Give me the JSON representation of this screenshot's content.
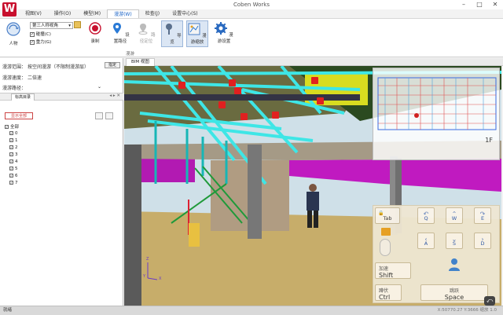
{
  "app": {
    "title": "Coben Works",
    "logo_letter": "W",
    "brand_color": "#c8102e"
  },
  "menu": {
    "items": [
      "视图(V)",
      "操作(O)",
      "模型(M)",
      "漫游(W)",
      "检查(J)",
      "设置中心(S)"
    ],
    "active_index": 3
  },
  "ribbon": {
    "view_mode": {
      "label": "人物",
      "select_value": "第三人称视角",
      "check1": "碰撞(C)",
      "check2": "重力(G)"
    },
    "buttons": [
      {
        "label": "录制",
        "icon": "record-icon"
      },
      {
        "label": "设置路径",
        "icon": "path-pin-icon"
      },
      {
        "label": "路径定位",
        "icon": "path-locate-icon"
      },
      {
        "label": "导览",
        "icon": "guide-icon"
      },
      {
        "label": "漫游缩放",
        "icon": "zoom-map-icon"
      },
      {
        "label": "漫游设置",
        "icon": "gear-icon"
      }
    ],
    "group_label": "漫游"
  },
  "left_panel": {
    "row1_label": "漫游范围：",
    "row1_value": "按空间漫游（不限制漫游层）",
    "row1_button": "指定",
    "row2_label": "漫游速度：",
    "row2_value": "二倍速",
    "row3_label": "漫游路径：",
    "tab_label": "标高目录",
    "action_button": "显示全部",
    "tree_root": "全部",
    "tree_items": [
      "0",
      "1",
      "2",
      "3",
      "4",
      "5",
      "6",
      "7"
    ]
  },
  "view": {
    "tab_label": "BIM 视图",
    "minimap_floor": "1F",
    "axis": {
      "x": "X",
      "y": "Y",
      "z": "Z"
    }
  },
  "controls": {
    "tab": "Tab",
    "keys": [
      {
        "t": "↶",
        "k": "Q"
      },
      {
        "t": "⌃",
        "k": "W"
      },
      {
        "t": "↷",
        "k": "E"
      },
      {
        "t": "‹",
        "k": "A"
      },
      {
        "t": "⌄",
        "k": "S"
      },
      {
        "t": "›",
        "k": "D"
      }
    ],
    "shift_label": "加速",
    "shift_key": "Shift",
    "ctrl_label": "蹲伏",
    "ctrl_key": "Ctrl",
    "space_label": "跳跃",
    "space_key": "Space"
  },
  "status": {
    "left": "就绪",
    "right": "X:50770.27 Y:3666  缩放 1.0"
  }
}
